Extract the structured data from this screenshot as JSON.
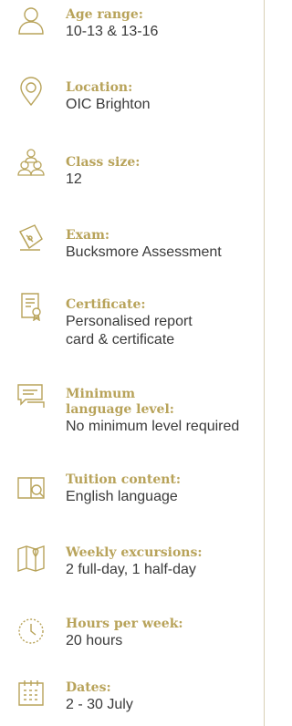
{
  "colors": {
    "accent": "#b8a35a",
    "text": "#3a3a3a",
    "divider": "#d8d0b6"
  },
  "items": [
    {
      "icon": "user-icon",
      "label": "Age range:",
      "value": "10-13 & 13-16"
    },
    {
      "icon": "location-pin-icon",
      "label": "Location:",
      "value": "OIC Brighton"
    },
    {
      "icon": "group-icon",
      "label": "Class size:",
      "value": "12"
    },
    {
      "icon": "pen-nib-icon",
      "label": "Exam:",
      "value": "Bucksmore Assessment"
    },
    {
      "icon": "certificate-icon",
      "label": "Certificate:",
      "value_lines": [
        "Personalised report",
        "card & certificate"
      ]
    },
    {
      "icon": "speech-bubbles-icon",
      "label_lines": [
        "Minimum",
        "language level:"
      ],
      "value": "No minimum level required"
    },
    {
      "icon": "book-search-icon",
      "label": "Tuition content:",
      "value": "English language"
    },
    {
      "icon": "map-icon",
      "label": "Weekly excursions:",
      "value": "2 full-day, 1 half-day"
    },
    {
      "icon": "clock-icon",
      "label": "Hours per week:",
      "value": "20 hours"
    },
    {
      "icon": "calendar-icon",
      "label": "Dates:",
      "value": "2 - 30 July"
    }
  ]
}
